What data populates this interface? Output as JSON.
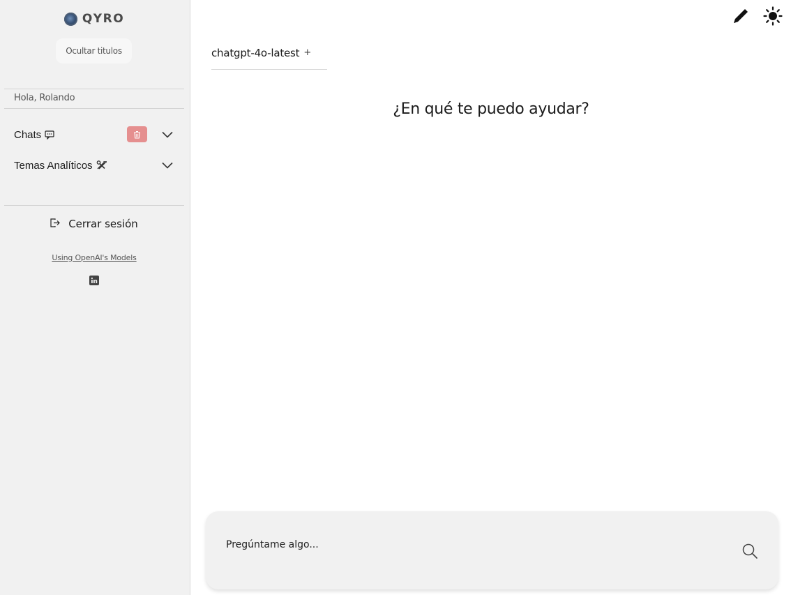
{
  "app": {
    "name": "QYRO"
  },
  "sidebar": {
    "hide_titles_label": "Ocultar titulos",
    "greeting": "Hola, Rolando",
    "sections": [
      {
        "label": "Chats",
        "emoji_icon": "speech-bubble-icon",
        "has_delete": true
      },
      {
        "label": "Temas Analíticos",
        "emoji_icon": "tools-icon",
        "has_delete": false
      }
    ],
    "logout_label": "Cerrar sesión",
    "openai_link": "Using OpenAI's Models",
    "social_icon": "linkedin-icon"
  },
  "header": {
    "tools": [
      "pencil-icon",
      "sun-icon"
    ],
    "model_tab": {
      "label": "chatgpt-4o-latest",
      "add": "+"
    }
  },
  "main": {
    "welcome": "¿En qué te puedo ayudar?"
  },
  "prompt": {
    "placeholder": "Pregúntame algo...",
    "value": ""
  },
  "colors": {
    "sidebar_bg": "#f1f1f1",
    "delete_button": "#e58f8f",
    "prompt_bg": "#f1f1f1"
  }
}
